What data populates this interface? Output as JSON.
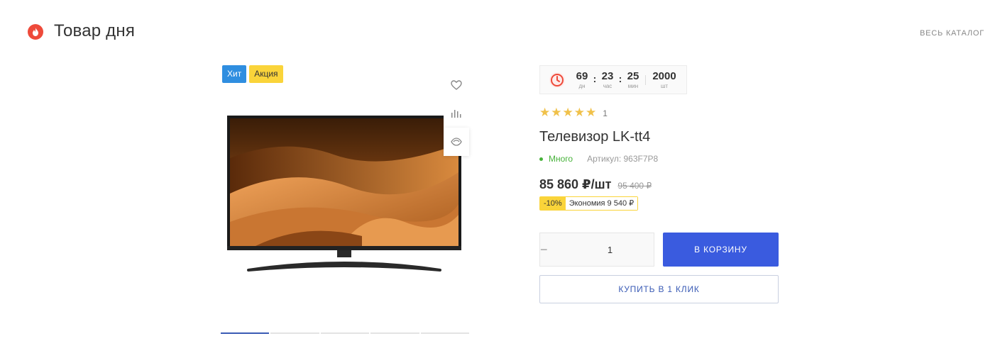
{
  "header": {
    "title": "Товар дня",
    "catalog_link": "ВЕСЬ КАТАЛОГ"
  },
  "gallery": {
    "badges": [
      "Хит",
      "Акция"
    ],
    "side_actions": [
      "heart-icon",
      "compare-icon",
      "eye-icon"
    ],
    "thumbnails_count": 5,
    "active_thumbnail": 1
  },
  "timer": {
    "days": "69",
    "days_unit": "дн",
    "hours": "23",
    "hours_unit": "час",
    "minutes": "25",
    "minutes_unit": "мин",
    "quantity": "2000",
    "quantity_unit": "шт",
    "separator": ":"
  },
  "rating": {
    "stars": "★★★★★",
    "count": "1"
  },
  "product": {
    "title": "Телевизор LK-tt4",
    "stock": "Много",
    "sku": "Артикул: 963F7P8",
    "price": "85 860 ₽/шт",
    "old_price": "95 400 ₽",
    "discount": "-10%",
    "saving": "Экономия 9 540 ₽"
  },
  "quantity": {
    "value": "1",
    "minus": "−",
    "plus": "+"
  },
  "buttons": {
    "cart": "В КОРЗИНУ",
    "one_click": "КУПИТЬ В 1 КЛИК"
  },
  "colors": {
    "accent": "#3a5bdf",
    "hit_badge": "#2f8ee0",
    "sale_badge": "#fad43a",
    "stock": "#47b23a",
    "fire": "#ee4a3a",
    "stars": "#f0c14a"
  }
}
